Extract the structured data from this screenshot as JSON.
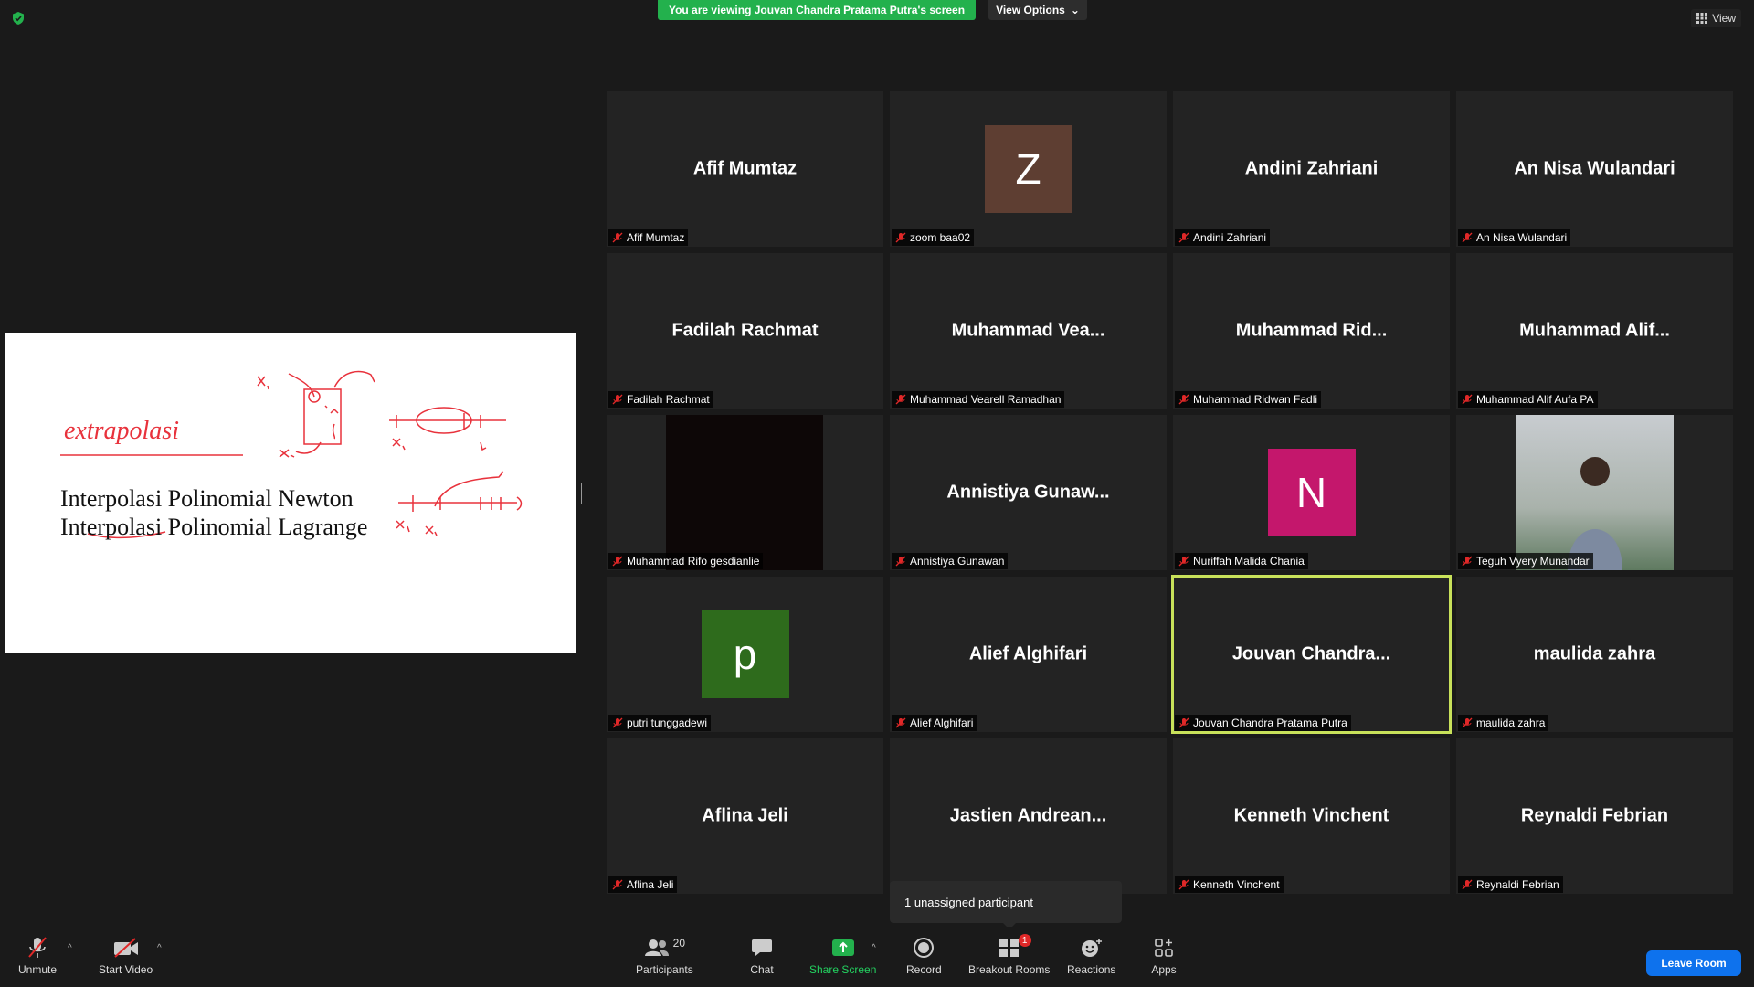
{
  "top": {
    "banner_text": "You are viewing Jouvan Chandra Pratama Putra's screen",
    "view_options_label": "View Options",
    "view_label": "View"
  },
  "shared_screen": {
    "handwritten_text": "extrapolasi",
    "line1": "Interpolasi Polinomial Newton",
    "line2": "Interpolasi Polinomial Lagrange"
  },
  "participants": [
    {
      "display": "Afif Mumtaz",
      "tag": "Afif Mumtaz",
      "type": "name"
    },
    {
      "display": "Z",
      "tag": "zoom baa02",
      "type": "avatar",
      "color": "#5e3e32"
    },
    {
      "display": "Andini Zahriani",
      "tag": "Andini Zahriani",
      "type": "name"
    },
    {
      "display": "An Nisa Wulandari",
      "tag": "An Nisa Wulandari",
      "type": "name"
    },
    {
      "display": "Fadilah Rachmat",
      "tag": "Fadilah Rachmat",
      "type": "name"
    },
    {
      "display": "Muhammad  Vea...",
      "tag": "Muhammad Vearell Ramadhan",
      "type": "name"
    },
    {
      "display": "Muhammad  Rid...",
      "tag": "Muhammad Ridwan Fadli",
      "type": "name"
    },
    {
      "display": "Muhammad  Alif...",
      "tag": "Muhammad Alif Aufa PA",
      "type": "name"
    },
    {
      "display": "",
      "tag": "Muhammad Rifo gesdianlie",
      "type": "video-dark"
    },
    {
      "display": "Annistiya  Gunaw...",
      "tag": "Annistiya Gunawan",
      "type": "name"
    },
    {
      "display": "N",
      "tag": "Nuriffah Malida Chania",
      "type": "avatar",
      "color": "#c4176c"
    },
    {
      "display": "",
      "tag": "Teguh Vyery Munandar",
      "type": "video-photo"
    },
    {
      "display": "p",
      "tag": "putri tunggadewi",
      "type": "avatar",
      "color": "#2e6b1c"
    },
    {
      "display": "Alief Alghifari",
      "tag": "Alief Alghifari",
      "type": "name"
    },
    {
      "display": "Jouvan  Chandra...",
      "tag": "Jouvan Chandra Pratama Putra",
      "type": "name",
      "active": true
    },
    {
      "display": "maulida zahra",
      "tag": "maulida zahra",
      "type": "name"
    },
    {
      "display": "Aflina Jeli",
      "tag": "Aflina Jeli",
      "type": "name"
    },
    {
      "display": "Jastien  Andrean...",
      "tag": "",
      "type": "name"
    },
    {
      "display": "Kenneth Vinchent",
      "tag": "Kenneth Vinchent",
      "type": "name"
    },
    {
      "display": "Reynaldi Febrian",
      "tag": "Reynaldi Febrian",
      "type": "name"
    }
  ],
  "tooltip": "1 unassigned participant",
  "toolbar": {
    "unmute": "Unmute",
    "start_video": "Start Video",
    "participants": "Participants",
    "participants_count": "20",
    "chat": "Chat",
    "share_screen": "Share Screen",
    "record": "Record",
    "breakout_rooms": "Breakout Rooms",
    "breakout_badge": "1",
    "reactions": "Reactions",
    "apps": "Apps",
    "leave": "Leave Room"
  },
  "colors": {
    "banner_green": "#23b14d",
    "active_speaker": "#c8e15a",
    "leave_blue": "#0e72ed",
    "mic_off_red": "#e02828"
  }
}
